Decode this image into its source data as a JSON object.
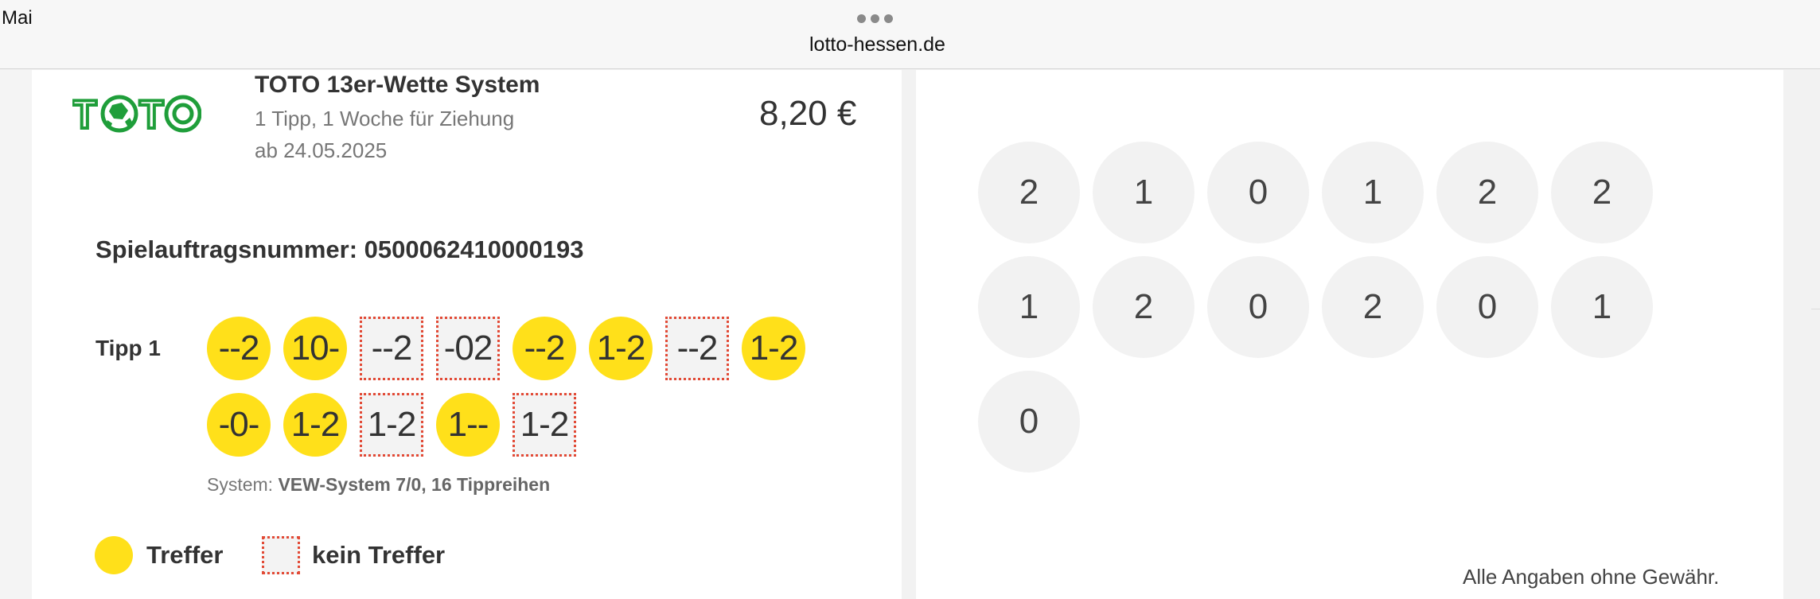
{
  "status_bar": {
    "time": "Mai"
  },
  "browser": {
    "url": "lotto-hessen.de",
    "menu_icon": "more-dots-icon"
  },
  "product": {
    "logo_text": "TOTO",
    "title": "TOTO 13er-Wette System",
    "subtitle_line1": "1 Tipp, 1 Woche für Ziehung",
    "subtitle_line2": "ab 24.05.2025",
    "price": "8,20 €"
  },
  "order": {
    "label": "Spielauftragsnummer: 0500062410000193"
  },
  "tipp": {
    "label": "Tipp 1",
    "row1": [
      {
        "value": "--2",
        "status": "hit"
      },
      {
        "value": "10-",
        "status": "hit"
      },
      {
        "value": "--2",
        "status": "miss"
      },
      {
        "value": "-02",
        "status": "miss"
      },
      {
        "value": "--2",
        "status": "hit"
      },
      {
        "value": "1-2",
        "status": "hit"
      },
      {
        "value": "--2",
        "status": "miss"
      },
      {
        "value": "1-2",
        "status": "hit"
      }
    ],
    "row2": [
      {
        "value": "-0-",
        "status": "hit"
      },
      {
        "value": "1-2",
        "status": "hit"
      },
      {
        "value": "1-2",
        "status": "miss"
      },
      {
        "value": "1--",
        "status": "hit"
      },
      {
        "value": "1-2",
        "status": "miss"
      }
    ],
    "system_label": "System:",
    "system_value": "VEW-System 7/0, 16 Tippreihen"
  },
  "legend": {
    "hit": "Treffer",
    "miss": "kein Treffer"
  },
  "results": {
    "row1": [
      "2",
      "1",
      "0",
      "1",
      "2",
      "2"
    ],
    "row2": [
      "1",
      "2",
      "0",
      "2",
      "0",
      "1"
    ],
    "row3": [
      "0"
    ]
  },
  "disclaimer": "Alle Angaben ohne Gewähr.",
  "colors": {
    "hit": "#ffe01a",
    "miss_border": "#e24a36",
    "logo_green": "#1f9e3a"
  }
}
